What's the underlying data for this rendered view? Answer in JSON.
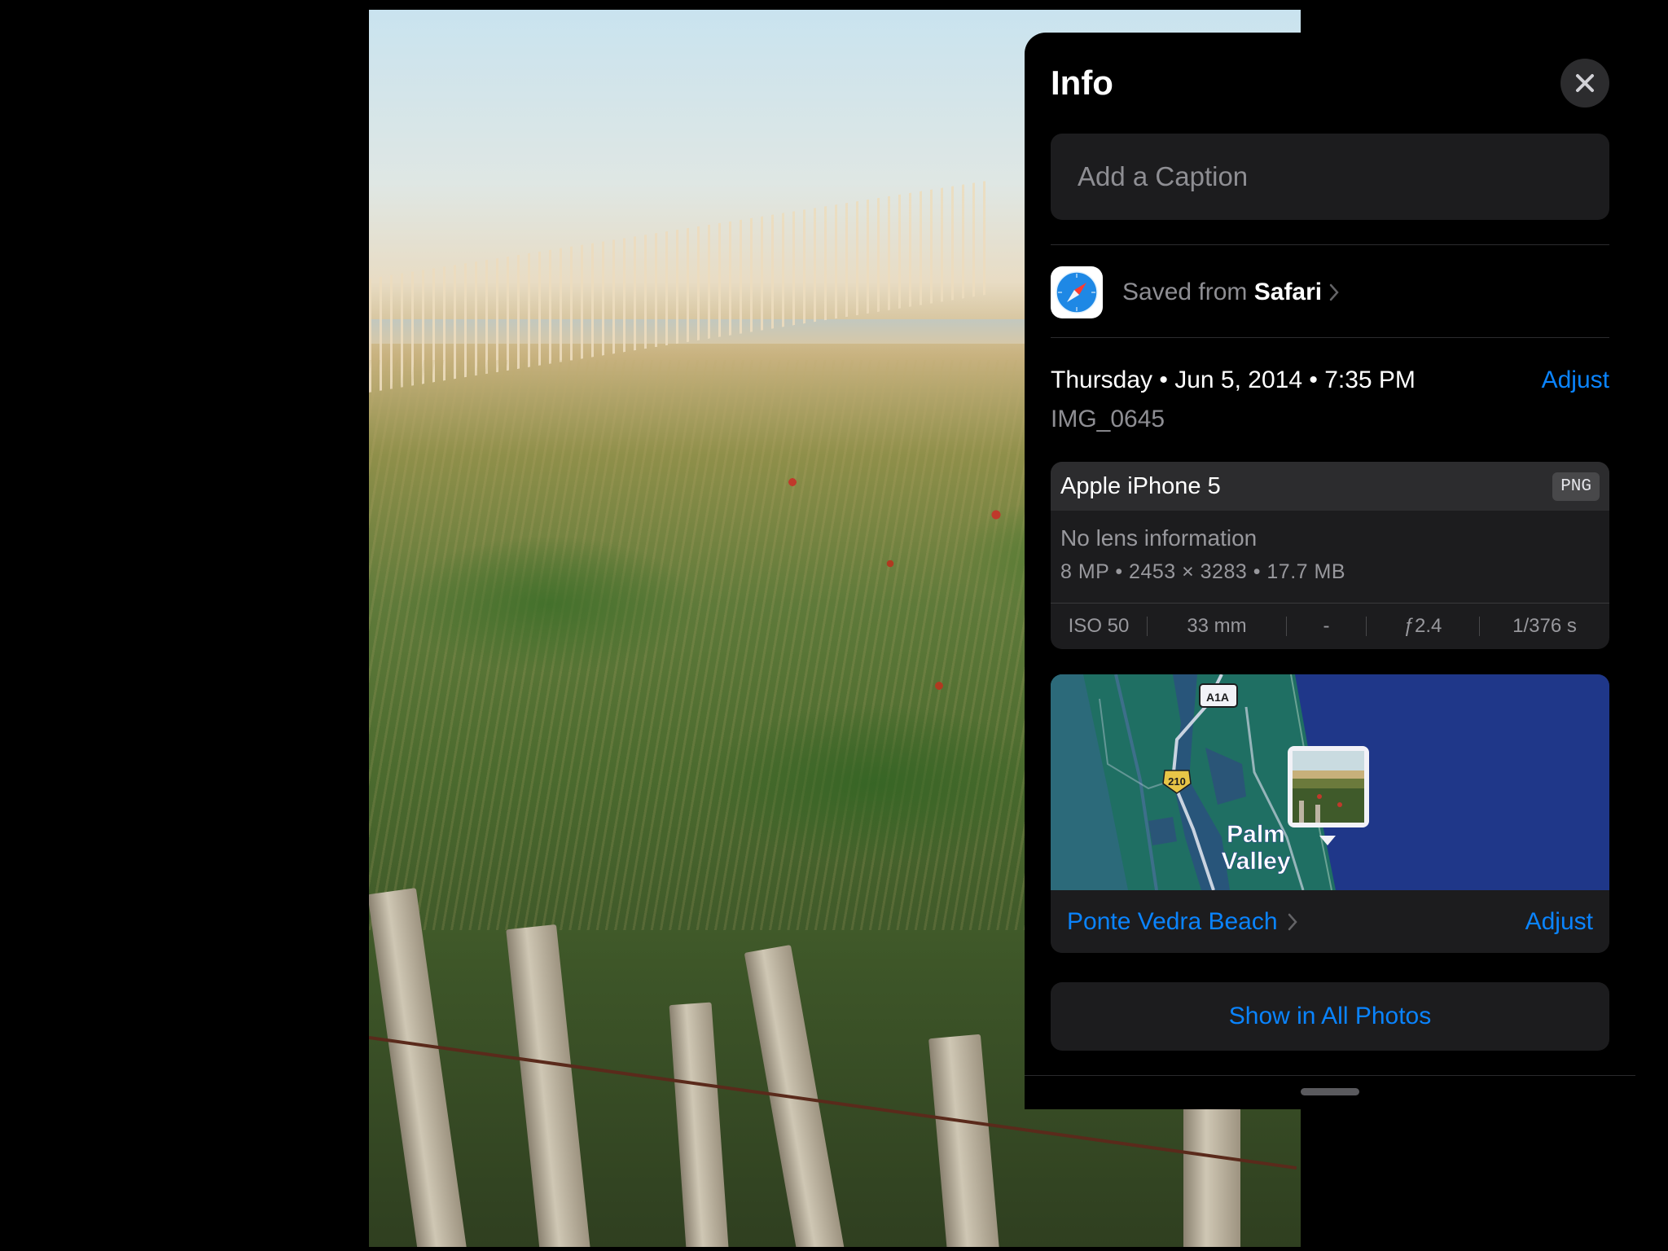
{
  "info_panel": {
    "title": "Info",
    "caption_placeholder": "Add a Caption",
    "source": {
      "prefix": "Saved from",
      "app": "Safari"
    },
    "date_line": "Thursday • Jun 5, 2014 • 7:35 PM",
    "adjust_label": "Adjust",
    "filename": "IMG_0645",
    "camera": {
      "device": "Apple iPhone 5",
      "format": "PNG",
      "lens": "No lens information",
      "specs": "8 MP  •  2453 × 3283  •  17.7 MB",
      "exif": {
        "iso": "ISO 50",
        "focal_length": "33 mm",
        "exposure_bias": "-",
        "aperture": "ƒ2.4",
        "shutter": "1/376 s"
      }
    },
    "map": {
      "place_label_line1": "Palm",
      "place_label_line2": "Valley",
      "road_a1a": "A1A",
      "road_210": "210",
      "location_name": "Ponte Vedra Beach",
      "adjust_label": "Adjust"
    },
    "show_all_label": "Show in All Photos"
  },
  "colors": {
    "accent": "#0a84ff",
    "panel_bg": "#000000",
    "card_bg": "#1c1c1e",
    "secondary_text": "#8e8e93",
    "map_water": "#1f3789",
    "map_land": "#1f6f63"
  },
  "icons": {
    "close": "close-icon",
    "safari": "safari-icon",
    "chevron": "chevron-right-icon"
  }
}
